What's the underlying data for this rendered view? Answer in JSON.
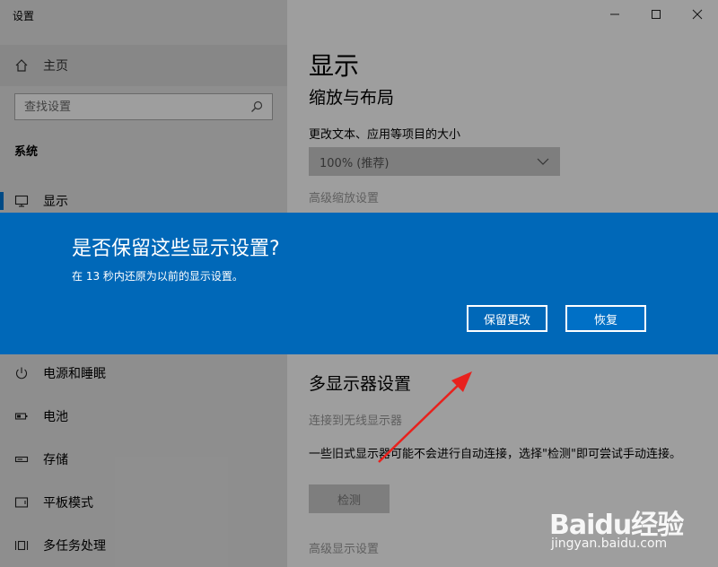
{
  "window": {
    "title": "设置",
    "minimize_icon": "minimize-icon",
    "maximize_icon": "maximize-icon",
    "close_icon": "close-icon"
  },
  "sidebar": {
    "home_label": "主页",
    "search_placeholder": "查找设置",
    "section_title": "系统",
    "items": [
      {
        "label": "显示",
        "icon": "monitor-icon",
        "active": true
      },
      {
        "label": "电源和睡眠",
        "icon": "power-icon",
        "active": false
      },
      {
        "label": "电池",
        "icon": "battery-icon",
        "active": false
      },
      {
        "label": "存储",
        "icon": "storage-icon",
        "active": false
      },
      {
        "label": "平板模式",
        "icon": "tablet-icon",
        "active": false
      },
      {
        "label": "多任务处理",
        "icon": "multitask-icon",
        "active": false
      }
    ]
  },
  "main": {
    "title": "显示",
    "scale_heading": "缩放与布局",
    "scale_label": "更改文本、应用等项目的大小",
    "scale_value": "100% (推荐)",
    "advanced_scaling_link": "高级缩放设置",
    "multi_display_heading": "多显示器设置",
    "wireless_link": "连接到无线显示器",
    "detect_description": "一些旧式显示器可能不会进行自动连接，选择\"检测\"即可尝试手动连接。",
    "detect_button": "检测",
    "advanced_display_link": "高级显示设置"
  },
  "dialog": {
    "title": "是否保留这些显示设置?",
    "message": "在 13 秒内还原为以前的显示设置。",
    "keep_button": "保留更改",
    "revert_button": "恢复",
    "countdown_seconds": 13
  },
  "watermark": {
    "brand": "Baidu经验",
    "url": "jingyan.baidu.com"
  },
  "colors": {
    "dialog_bg": "#0068b8",
    "accent": "#0078d7",
    "arrow": "#e8211d"
  }
}
